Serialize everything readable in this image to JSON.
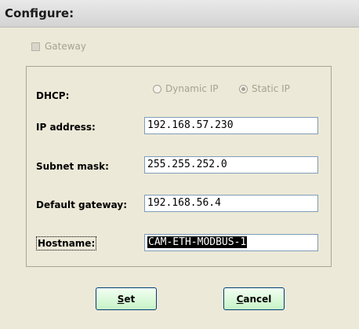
{
  "header": {
    "title": "Configure:"
  },
  "gateway": {
    "label": "Gateway",
    "checked": false,
    "enabled": false
  },
  "dhcp": {
    "label": "DHCP:",
    "options": [
      {
        "label": "Dynamic IP",
        "selected": false
      },
      {
        "label": "Static IP",
        "selected": true
      }
    ]
  },
  "fields": {
    "ip_address": {
      "label": "IP address:",
      "value": "192.168.57.230"
    },
    "subnet_mask": {
      "label": "Subnet mask:",
      "value": "255.255.252.0"
    },
    "default_gateway": {
      "label": "Default gateway:",
      "value": "192.168.56.4"
    },
    "hostname": {
      "label": "Hostname:",
      "value": "CAM-ETH-MODBUS-1"
    }
  },
  "buttons": {
    "set": {
      "label": "Set",
      "accel": "S",
      "rest": "et"
    },
    "cancel": {
      "label": "Cancel",
      "accel": "C",
      "rest": "ancel"
    }
  },
  "colors": {
    "button_bg": "#c7f3c7",
    "background": "#ece9d8",
    "disabled": "#a6a292"
  }
}
